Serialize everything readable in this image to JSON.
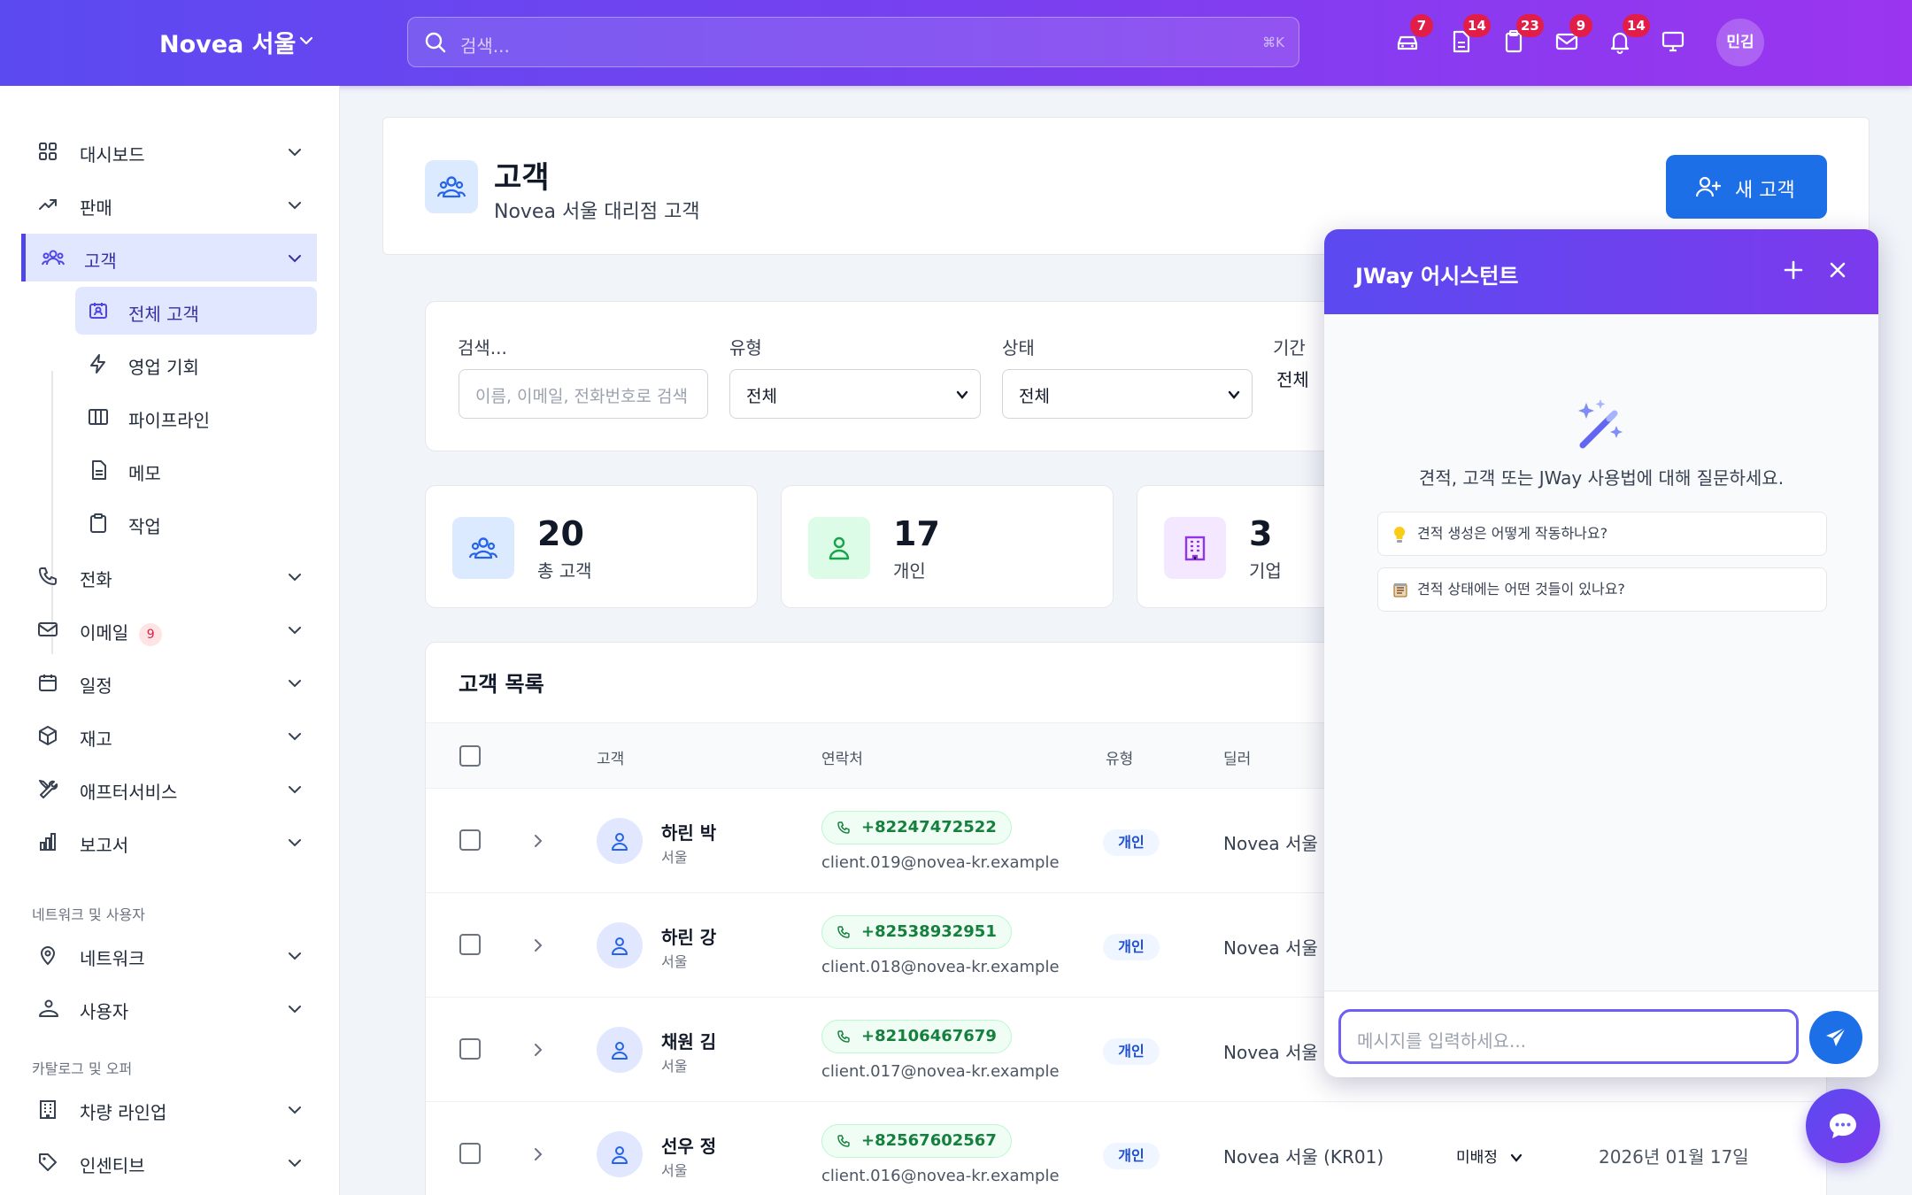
{
  "topbar": {
    "brand": "Novea 서울",
    "search_placeholder": "검색...",
    "search_shortcut": "⌘K",
    "icons": [
      {
        "name": "car-icon",
        "badge": "7"
      },
      {
        "name": "document-icon",
        "badge": "14"
      },
      {
        "name": "clipboard-icon",
        "badge": "23"
      },
      {
        "name": "mail-icon",
        "badge": "9"
      },
      {
        "name": "bell-icon",
        "badge": "14"
      },
      {
        "name": "monitor-icon",
        "badge": ""
      }
    ],
    "user_initials": "민김"
  },
  "sidebar": {
    "items": [
      {
        "label": "대시보드",
        "icon": "grid-icon"
      },
      {
        "label": "판매",
        "icon": "trending-up-icon"
      },
      {
        "label": "고객",
        "icon": "users-icon"
      },
      {
        "label": "전화",
        "icon": "phone-icon"
      },
      {
        "label": "이메일",
        "icon": "mail-icon",
        "badge": "9"
      },
      {
        "label": "일정",
        "icon": "calendar-icon"
      },
      {
        "label": "재고",
        "icon": "box-icon"
      },
      {
        "label": "애프터서비스",
        "icon": "tools-icon"
      },
      {
        "label": "보고서",
        "icon": "bar-chart-icon"
      }
    ],
    "sub_items": [
      {
        "label": "전체 고객",
        "icon": "contacts-icon"
      },
      {
        "label": "영업 기회",
        "icon": "lightning-icon"
      },
      {
        "label": "파이프라인",
        "icon": "columns-icon"
      },
      {
        "label": "메모",
        "icon": "note-icon"
      },
      {
        "label": "작업",
        "icon": "clipboard-icon"
      }
    ],
    "section_network": "네트워크 및 사용자",
    "network_items": [
      {
        "label": "네트워크",
        "icon": "map-pin-icon"
      },
      {
        "label": "사용자",
        "icon": "user-group-icon"
      }
    ],
    "section_catalog": "카탈로그 및 오퍼",
    "catalog_items": [
      {
        "label": "차량 라인업",
        "icon": "building-icon"
      },
      {
        "label": "인센티브",
        "icon": "tag-icon"
      }
    ]
  },
  "page": {
    "title": "고객",
    "subtitle": "Novea 서울 대리점 고객",
    "new_button": "새 고객"
  },
  "filters": {
    "search_label": "검색...",
    "search_placeholder": "이름, 이메일, 전화번호로 검색",
    "type_label": "유형",
    "type_value": "전체",
    "status_label": "상태",
    "status_value": "전체",
    "period_label": "기간",
    "period_value": "전체"
  },
  "stats": [
    {
      "value": "20",
      "label": "총 고객",
      "color": "#2563eb"
    },
    {
      "value": "17",
      "label": "개인",
      "color": "#16a34a"
    },
    {
      "value": "3",
      "label": "기업",
      "color": "#9333ea"
    }
  ],
  "list": {
    "title": "고객 목록",
    "columns": [
      "고객",
      "연락처",
      "유형",
      "딜러"
    ],
    "rows": [
      {
        "name": "하린 박",
        "city": "서울",
        "phone": "+82247472522",
        "email": "client.019@novea-kr.example",
        "type": "개인",
        "dealer": "Novea 서울 (",
        "assigned": "",
        "date": ""
      },
      {
        "name": "하린 강",
        "city": "서울",
        "phone": "+82538932951",
        "email": "client.018@novea-kr.example",
        "type": "개인",
        "dealer": "Novea 서울 (",
        "assigned": "",
        "date": ""
      },
      {
        "name": "채원 김",
        "city": "서울",
        "phone": "+82106467679",
        "email": "client.017@novea-kr.example",
        "type": "개인",
        "dealer": "Novea 서울 (",
        "assigned": "",
        "date": ""
      },
      {
        "name": "선우 정",
        "city": "서울",
        "phone": "+82567602567",
        "email": "client.016@novea-kr.example",
        "type": "개인",
        "dealer": "Novea 서울 (KR01)",
        "assigned": "미배정",
        "date": "2026년 01월 17일"
      }
    ]
  },
  "chat": {
    "title": "JWay 어시스턴트",
    "hint": "견적, 고객 또는 JWay 사용법에 대해 질문하세요.",
    "suggestions": [
      "견적 생성은 어떻게 작동하나요?",
      "견적 상태에는 어떤 것들이 있나요?"
    ],
    "input_placeholder": "메시지를 입력하세요..."
  },
  "colors": {
    "primary": "#5b4af0",
    "accent": "#1d6fe8",
    "badge": "#e11d48"
  }
}
